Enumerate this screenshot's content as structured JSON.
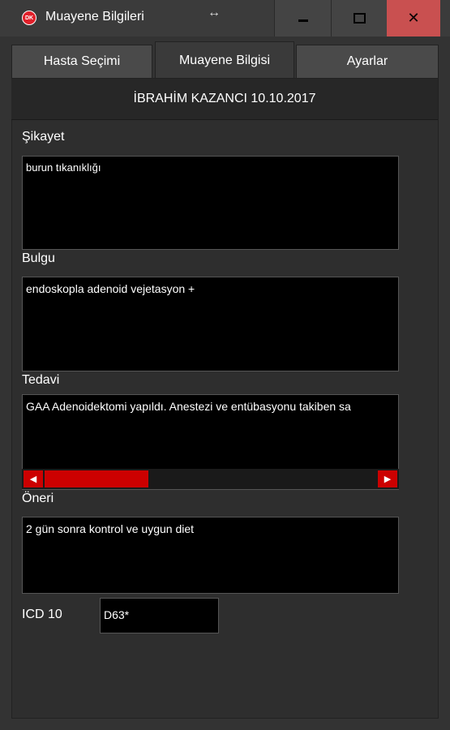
{
  "window": {
    "title": "Muayene Bilgileri",
    "logo_text": "DK",
    "resize_glyph": "↔",
    "close_glyph": "✕"
  },
  "tabs": [
    {
      "label": "Hasta Seçimi",
      "active": false
    },
    {
      "label": "Muayene Bilgisi",
      "active": true
    },
    {
      "label": "Ayarlar",
      "active": false
    }
  ],
  "header": {
    "patient_line": "İBRAHİM KAZANCI 10.10.2017"
  },
  "fields": {
    "sikayet": {
      "label": "Şikayet",
      "value": "burun tıkanıklığı"
    },
    "bulgu": {
      "label": "Bulgu",
      "value": "endoskopla adenoid vejetasyon +"
    },
    "tedavi": {
      "label": "Tedavi",
      "value": "GAA Adenoidektomi yapıldı. Anestezi ve entübasyonu takiben sa"
    },
    "oneri": {
      "label": "Öneri",
      "value": "2 gün sonra kontrol ve uygun diet"
    },
    "icd10": {
      "label": "ICD 10",
      "value": "D63*"
    }
  },
  "scrollbar": {
    "left_arrow": "◀",
    "right_arrow": "▶",
    "accent": "#cc0000"
  },
  "colors": {
    "close_button": "#c95050",
    "scroll_accent": "#cc0000",
    "background": "#2e2e2e"
  }
}
